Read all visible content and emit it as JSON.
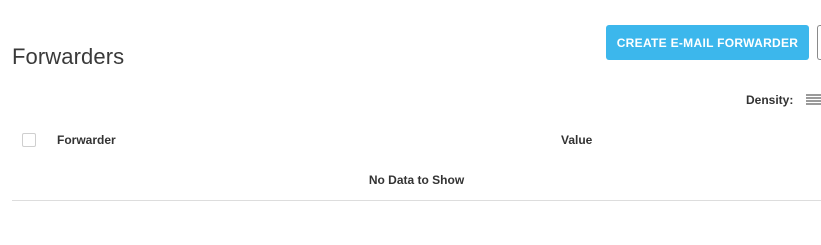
{
  "header": {
    "title": "Forwarders",
    "create_button_label": "CREATE E-MAIL FORWARDER"
  },
  "toolbar": {
    "density_label": "Density:",
    "density_icon": "list-density-icon"
  },
  "table": {
    "columns": [
      "Forwarder",
      "Value"
    ],
    "rows": [],
    "empty_message": "No Data to Show"
  },
  "colors": {
    "primary": "#3cb7ec",
    "text": "#333333",
    "divider": "#dddddd"
  }
}
